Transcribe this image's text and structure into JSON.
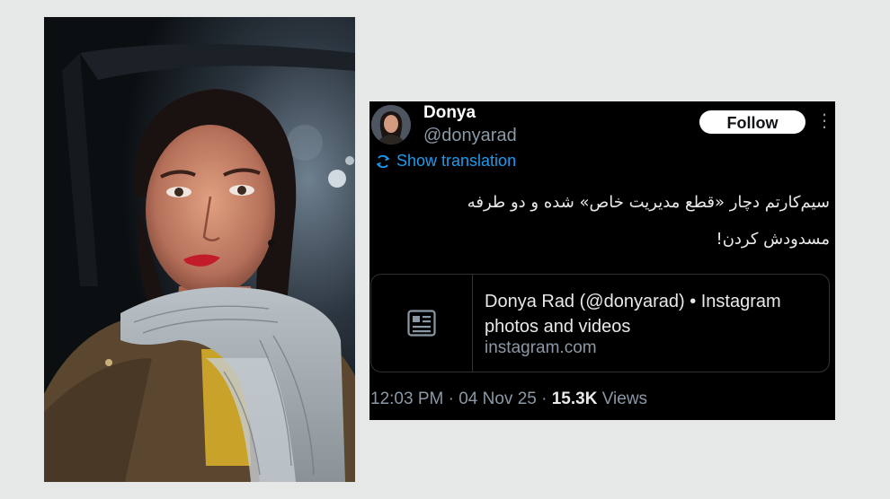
{
  "photo": {
    "icon": "portrait-photo"
  },
  "tweet": {
    "author": {
      "display_name": "Donya",
      "handle": "@donyarad",
      "avatar_icon": "avatar-photo"
    },
    "follow_label": "Follow",
    "more_icon": "more-vertical-icon",
    "more_glyph": "⋮",
    "show_translation": "Show translation",
    "text_line1": "سیم‌کارتم دچار «قطع مدیریت خاص» شده و دو طرفه",
    "text_line2": "مسدودش کردن!",
    "card": {
      "title": "Donya Rad (@donyarad) • Instagram photos and videos",
      "domain": "instagram.com",
      "thumb_icon": "article-icon"
    },
    "meta": {
      "time": "12:03 PM",
      "sep1": " · ",
      "date": "04 Nov 25",
      "sep2": " · ",
      "views_count": "15.3K",
      "views_label": " Views"
    }
  },
  "colors": {
    "page_bg": "#e6e8e8",
    "tweet_bg": "#000000",
    "link_blue": "#1d9bf0",
    "secondary_text": "#8b98a5",
    "follow_bg": "#ffffff"
  }
}
